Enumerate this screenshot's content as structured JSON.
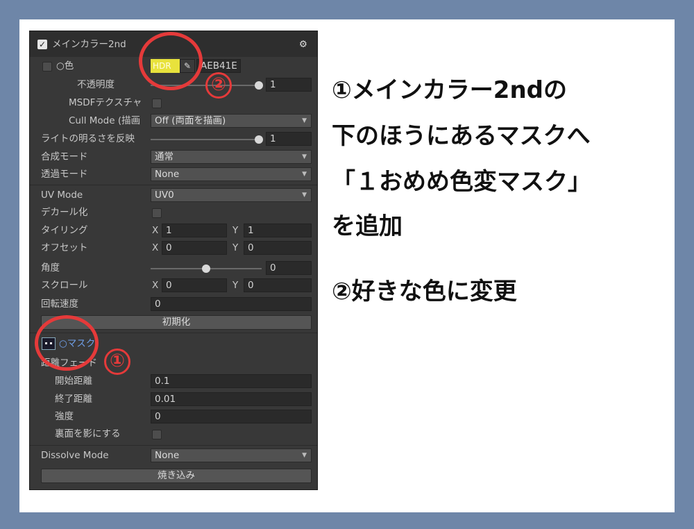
{
  "panel": {
    "title": "メインカラー2nd",
    "gear": "⚙",
    "color_row": {
      "label": "○色",
      "hdr": "HDR",
      "picker": "✎",
      "hex": "AEB41E"
    },
    "opacity": {
      "label": "不透明度",
      "value": "1",
      "level": 1.0
    },
    "msdf": {
      "label": "MSDFテクスチャ"
    },
    "cull": {
      "label": "Cull Mode (描画",
      "value": "Off (両面を描画)"
    },
    "light": {
      "label": "ライトの明るさを反映",
      "value": "1",
      "level": 1.0
    },
    "blend": {
      "label": "合成モード",
      "value": "通常"
    },
    "transparency": {
      "label": "透過モード",
      "value": "None"
    },
    "uv": {
      "label": "UV Mode",
      "value": "UV0"
    },
    "decal": {
      "label": "デカール化"
    },
    "tiling": {
      "label": "タイリング",
      "x_label": "X",
      "x": "1",
      "y_label": "Y",
      "y": "1"
    },
    "offset": {
      "label": "オフセット",
      "x_label": "X",
      "x": "0",
      "y_label": "Y",
      "y": "0"
    },
    "angle": {
      "label": "角度",
      "value": "0",
      "level": 0.5
    },
    "scroll": {
      "label": "スクロール",
      "x_label": "X",
      "x": "0",
      "y_label": "Y",
      "y": "0"
    },
    "rotation": {
      "label": "回転速度",
      "value": "0"
    },
    "reset_button": "初期化",
    "mask": {
      "label": "○マスク"
    },
    "distance_fade": {
      "label": "距離フェード"
    },
    "fade_start": {
      "label": "開始距離",
      "value": "0.1"
    },
    "fade_end": {
      "label": "終了距離",
      "value": "0.01"
    },
    "strength": {
      "label": "強度",
      "value": "0"
    },
    "backface": {
      "label": "裏面を影にする"
    },
    "dissolve": {
      "label": "Dissolve Mode",
      "value": "None"
    },
    "bake_button": "焼き込み"
  },
  "annotations": {
    "badge1": "①",
    "badge2": "②"
  },
  "instructions": {
    "line1": "①メインカラー2ndの",
    "line2": "下のほうにあるマスクへ",
    "line3": "「１おめめ色変マスク」",
    "line4": "を追加",
    "line5": "②好きな色に変更"
  },
  "colors": {
    "background": "#6e86a8",
    "accent_red": "#e53a3a",
    "hdr_swatch": "#e8e23c"
  }
}
